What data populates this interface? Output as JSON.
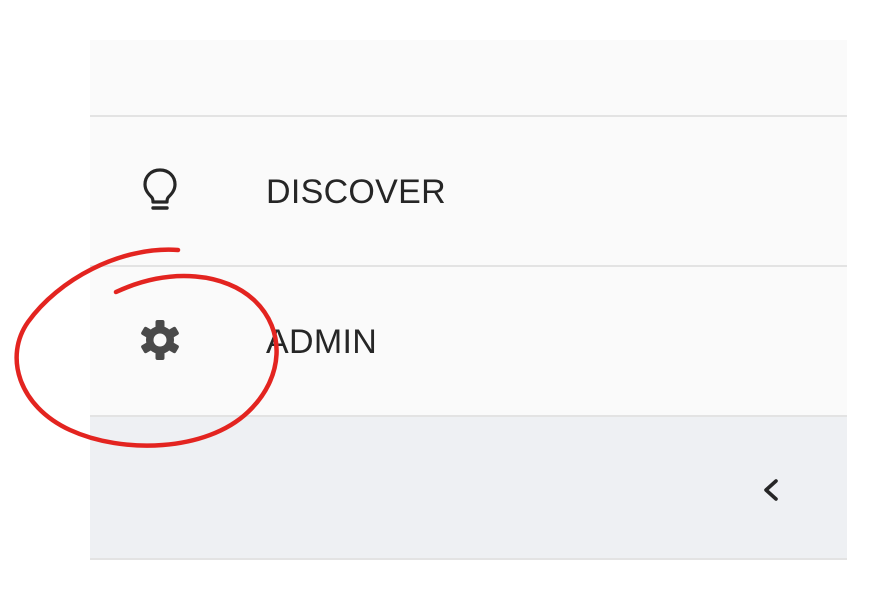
{
  "sidebar": {
    "items": [
      {
        "label": "DISCOVER",
        "icon": "lightbulb-icon"
      },
      {
        "label": "ADMIN",
        "icon": "gear-icon"
      }
    ],
    "collapse_icon": "chevron-left-icon"
  },
  "colors": {
    "sidebar_bg": "#fafafa",
    "collapse_bg": "#eef0f3",
    "divider": "#e3e3e3",
    "text": "#262626",
    "icon": "#4a4a4a",
    "annotation": "#e32420"
  }
}
